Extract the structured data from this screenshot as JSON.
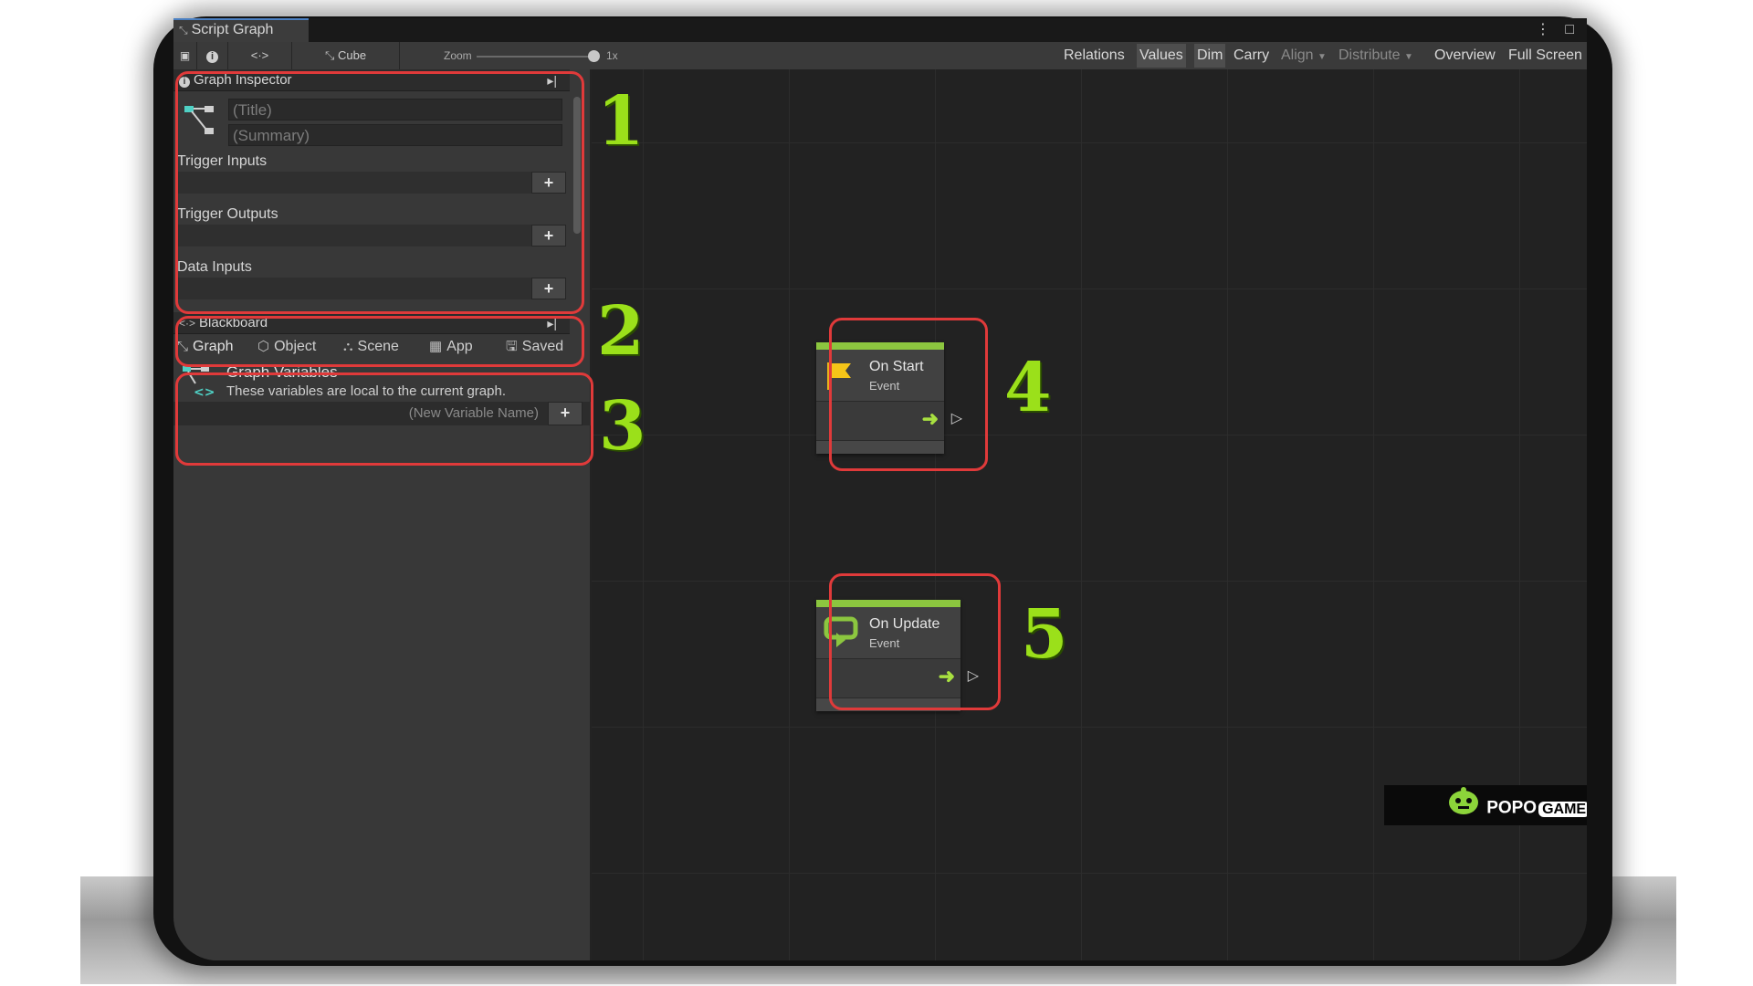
{
  "window": {
    "tab_title": "Script Graph",
    "menu_glyph": "⋮",
    "maximize_glyph": "□"
  },
  "toolbar": {
    "lock_glyph": "🔒",
    "info_glyph": "i",
    "variables_glyph": "<·>",
    "target_name": "Cube",
    "zoom_label": "Zoom",
    "zoom_level": "1x",
    "zoom_fraction": 1.0,
    "right_buttons": [
      {
        "label": "Relations",
        "state": "normal"
      },
      {
        "label": "Values",
        "state": "active"
      },
      {
        "label": "Dim",
        "state": "active"
      },
      {
        "label": "Carry",
        "state": "normal"
      },
      {
        "label": "Align",
        "state": "disabled"
      },
      {
        "label": "Distribute",
        "state": "disabled"
      },
      {
        "label": "Overview",
        "state": "normal"
      },
      {
        "label": "Full Screen",
        "state": "normal"
      }
    ]
  },
  "graph_inspector": {
    "header": "Graph Inspector",
    "title_placeholder": "(Title)",
    "summary_placeholder": "(Summary)",
    "sections": [
      "Trigger Inputs",
      "Trigger Outputs",
      "Data Inputs"
    ],
    "add_glyph": "+"
  },
  "blackboard": {
    "header": "Blackboard",
    "tabs": [
      {
        "label": "Graph",
        "icon": "graph-icon",
        "glyph": "⤡"
      },
      {
        "label": "Object",
        "icon": "cube-icon",
        "glyph": "⬡"
      },
      {
        "label": "Scene",
        "icon": "scene-icon",
        "glyph": "⛬"
      },
      {
        "label": "App",
        "icon": "app-icon",
        "glyph": "▦"
      },
      {
        "label": "Saved",
        "icon": "floppy-icon",
        "glyph": "🖫"
      }
    ],
    "variables_title": "Graph Variables",
    "variables_description": "These variables are local to the current graph.",
    "new_variable_placeholder": "(New Variable Name)",
    "add_glyph": "+"
  },
  "nodes": [
    {
      "title": "On Start",
      "subtitle": "Event",
      "icon": "flag-icon"
    },
    {
      "title": "On Update",
      "subtitle": "Event",
      "icon": "loop-icon"
    }
  ],
  "annotations": [
    "1",
    "2",
    "3",
    "4",
    "5"
  ],
  "watermark": {
    "brand": "POPO",
    "badge": "GAME"
  },
  "colors": {
    "highlight": "#e03a3a",
    "annotation": "#9be01a",
    "event_bar": "#8cc63f",
    "flow_arrow": "#a8e040"
  }
}
